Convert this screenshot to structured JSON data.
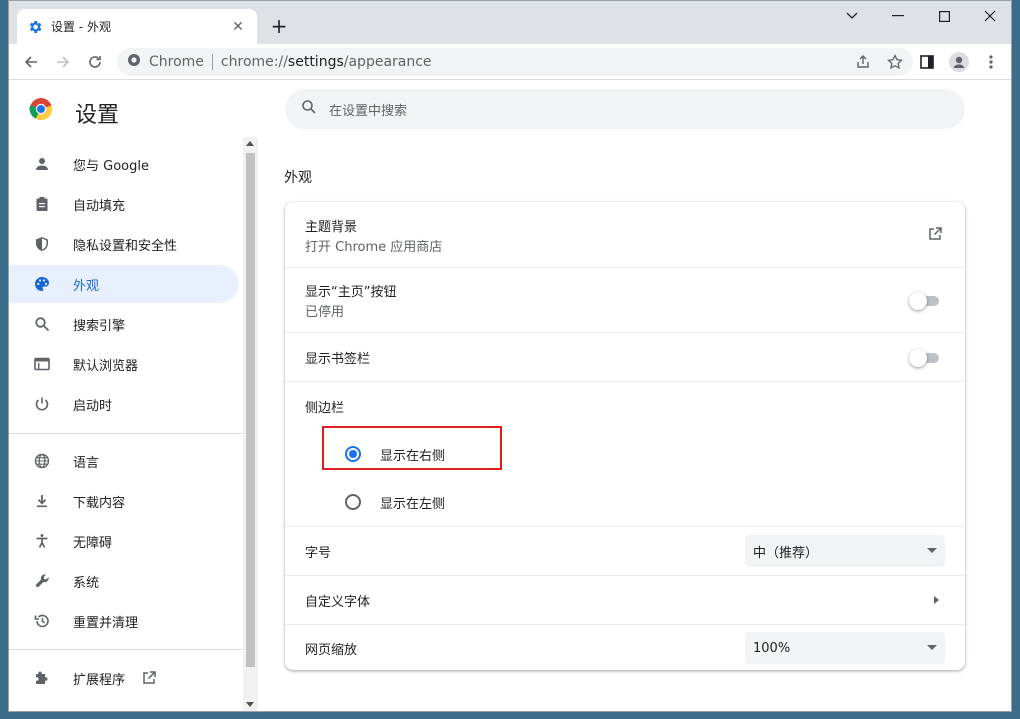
{
  "window": {
    "tab_title": "设置 - 外观",
    "new_tab": "+"
  },
  "toolbar": {
    "omnibox_chip": "Chrome",
    "url_prefix": "chrome://",
    "url_main": "settings",
    "url_suffix": "/appearance"
  },
  "page": {
    "title": "设置",
    "search_placeholder": "在设置中搜索"
  },
  "sidebar": {
    "items": [
      {
        "label": "您与 Google",
        "icon": "person-icon"
      },
      {
        "label": "自动填充",
        "icon": "clipboard-icon"
      },
      {
        "label": "隐私设置和安全性",
        "icon": "shield-icon"
      },
      {
        "label": "外观",
        "icon": "palette-icon",
        "active": true
      },
      {
        "label": "搜索引擎",
        "icon": "search-icon"
      },
      {
        "label": "默认浏览器",
        "icon": "browser-icon"
      },
      {
        "label": "启动时",
        "icon": "power-icon"
      },
      {
        "label": "语言",
        "icon": "globe-icon"
      },
      {
        "label": "下载内容",
        "icon": "download-icon"
      },
      {
        "label": "无障碍",
        "icon": "accessibility-icon"
      },
      {
        "label": "系统",
        "icon": "wrench-icon"
      },
      {
        "label": "重置并清理",
        "icon": "history-icon"
      },
      {
        "label": "扩展程序",
        "icon": "puzzle-icon"
      }
    ]
  },
  "appearance": {
    "section_title": "外观",
    "theme_label": "主题背景",
    "theme_sub": "打开 Chrome 应用商店",
    "home_label": "显示“主页”按钮",
    "home_sub": "已停用",
    "bookmarks_label": "显示书签栏",
    "sidepanel_label": "侧边栏",
    "sidepanel_right": "显示在右侧",
    "sidepanel_left": "显示在左侧",
    "sidepanel_selected": "right",
    "fontsize_label": "字号",
    "fontsize_value": "中（推荐）",
    "customfont_label": "自定义字体",
    "zoom_label": "网页缩放",
    "zoom_value": "100%"
  },
  "colors": {
    "accent": "#1a73e8",
    "highlight_box": "#e02020"
  }
}
